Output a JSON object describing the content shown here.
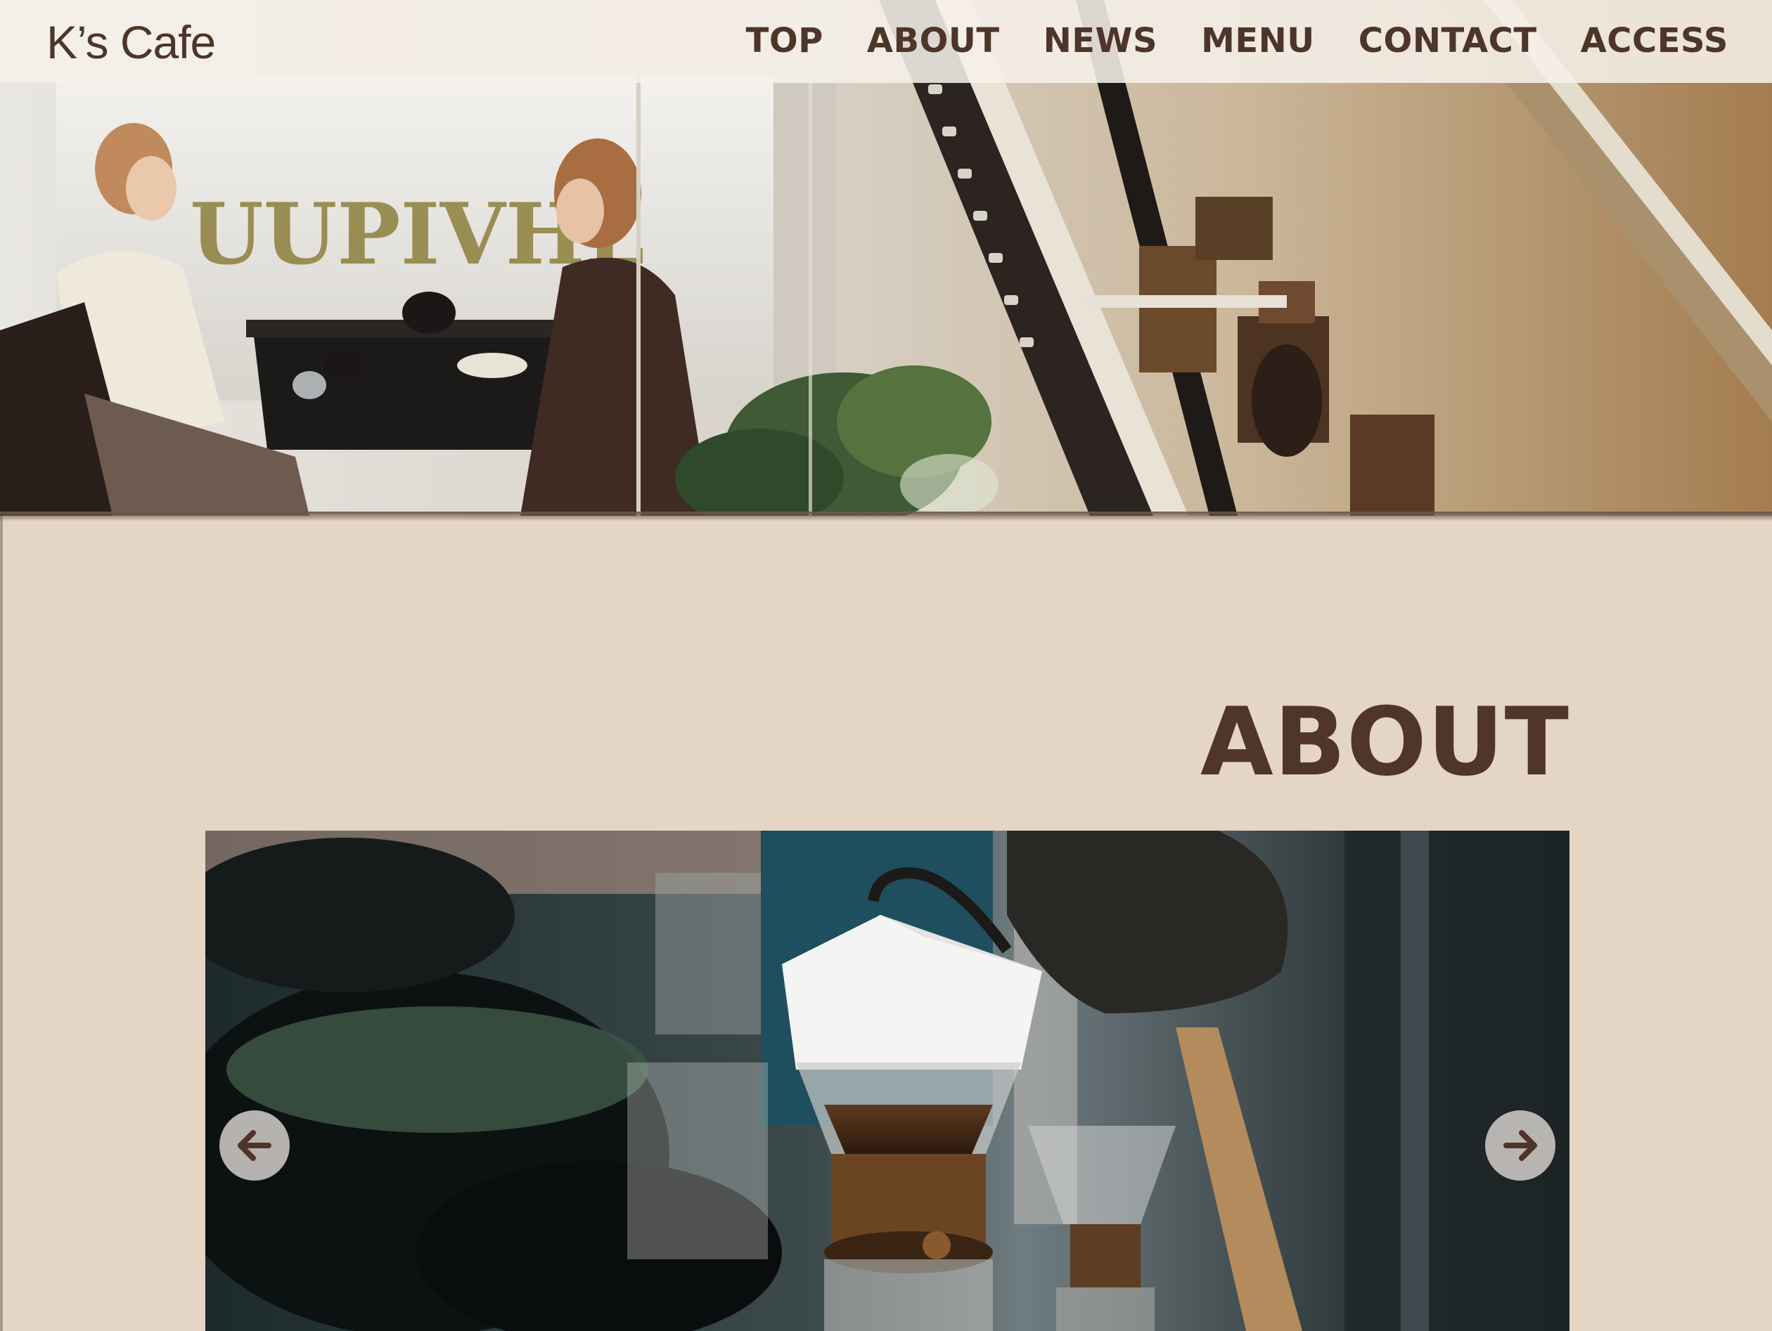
{
  "header": {
    "logo": "K’s Cafe",
    "nav": [
      "TOP",
      "ABOUT",
      "NEWS",
      "MENU",
      "CONTACT",
      "ACCESS"
    ]
  },
  "hero": {
    "image": "cafe-interior-photo",
    "window_lettering": "UUPIVHL"
  },
  "about": {
    "title": "ABOUT",
    "slider": {
      "image": "pour-over-coffee-photo",
      "prev_icon": "arrow-left-icon",
      "next_icon": "arrow-right-icon"
    }
  },
  "colors": {
    "text_brown": "#4d3529",
    "section_bg": "#e4d5c5",
    "nav_bg": "#f6f0e9"
  }
}
